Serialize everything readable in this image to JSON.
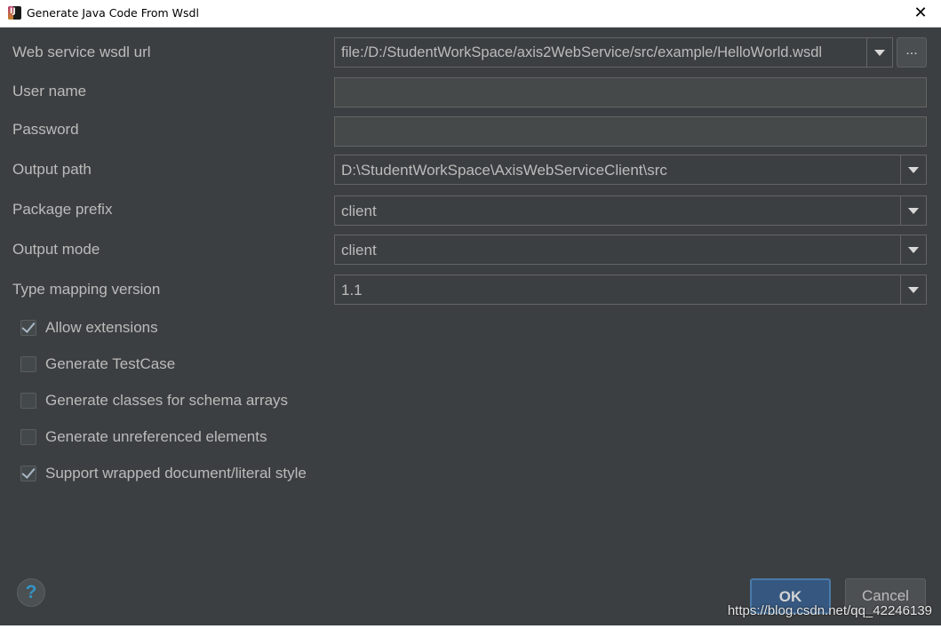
{
  "window": {
    "title": "Generate Java Code From Wsdl",
    "close_glyph": "✕"
  },
  "form": {
    "wsdl_url": {
      "label": "Web service wsdl url",
      "value": "file:/D:/StudentWorkSpace/axis2WebService/src/example/HelloWorld.wsdl",
      "browse_label": "..."
    },
    "user_name": {
      "label": "User name",
      "value": ""
    },
    "password": {
      "label": "Password",
      "value": ""
    },
    "output_path": {
      "label": "Output path",
      "value": "D:\\StudentWorkSpace\\AxisWebServiceClient\\src"
    },
    "package_prefix": {
      "label": "Package prefix",
      "value": "client"
    },
    "output_mode": {
      "label": "Output mode",
      "value": "client"
    },
    "type_mapping_version": {
      "label": "Type mapping version",
      "value": "1.1"
    }
  },
  "options": [
    {
      "label": "Allow extensions",
      "checked": true
    },
    {
      "label": "Generate TestCase",
      "checked": false
    },
    {
      "label": "Generate classes for schema arrays",
      "checked": false
    },
    {
      "label": "Generate unreferenced elements",
      "checked": false
    },
    {
      "label": "Support wrapped document/literal style",
      "checked": true
    }
  ],
  "footer": {
    "help_label": "?",
    "ok_label": "OK",
    "cancel_label": "Cancel"
  },
  "watermark": "https://blog.csdn.net/qq_42246139"
}
